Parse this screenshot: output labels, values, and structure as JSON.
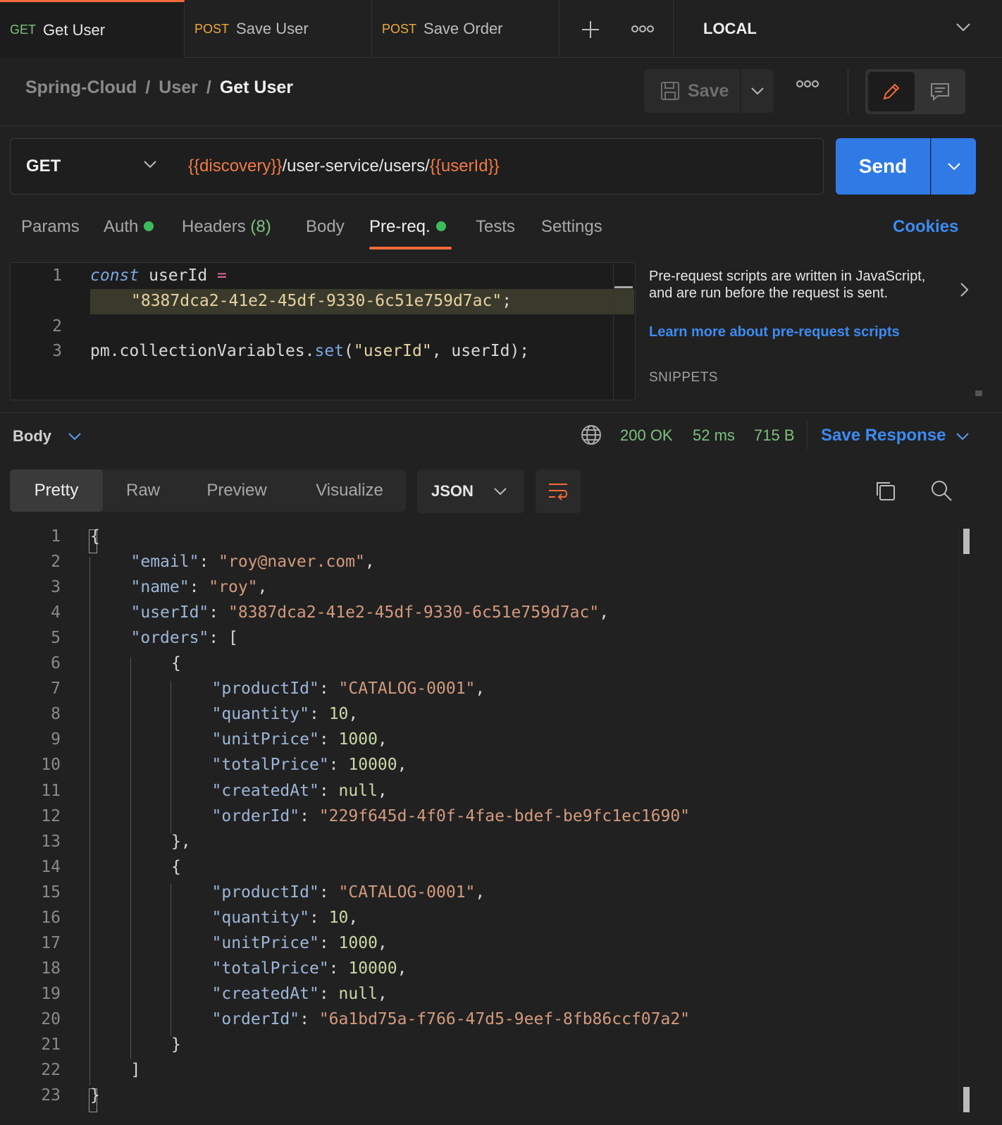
{
  "tabs": [
    {
      "method": "GET",
      "label": "Get User"
    },
    {
      "method": "POST",
      "label": "Save User"
    },
    {
      "method": "POST",
      "label": "Save Order"
    }
  ],
  "environment": "LOCAL",
  "breadcrumb": {
    "collection": "Spring-Cloud",
    "folder": "User",
    "request": "Get User"
  },
  "header": {
    "save_label": "Save"
  },
  "request": {
    "method": "GET",
    "url_var1": "{{discovery}}",
    "url_path": "/user-service/users/",
    "url_var2": "{{userId}}",
    "send_label": "Send"
  },
  "request_tabs": {
    "params": "Params",
    "auth": "Auth",
    "headers": "Headers",
    "headers_count": "(8)",
    "body": "Body",
    "prereq": "Pre-req.",
    "tests": "Tests",
    "settings": "Settings",
    "cookies": "Cookies"
  },
  "script": {
    "line_numbers": [
      "1",
      "2",
      "3"
    ],
    "l1_kw": "const",
    "l1_var": " userId ",
    "l1_op": "=",
    "l1b_str": "\"8387dca2-41e2-45df-9330-6c51e759d7ac\"",
    "l1b_end": ";",
    "l3_obj": "pm.collectionVariables.",
    "l3_fn": "set",
    "l3_open": "(",
    "l3_str": "\"userId\"",
    "l3_rest": ", userId);"
  },
  "info": {
    "text": "Pre-request scripts are written in JavaScript, and are run before the request is sent.",
    "link": "Learn more about pre-request scripts",
    "snippets": "SNIPPETS"
  },
  "response": {
    "body_label": "Body",
    "status": "200 OK",
    "time": "52 ms",
    "size": "715 B",
    "save_response": "Save Response",
    "views": [
      "Pretty",
      "Raw",
      "Preview",
      "Visualize"
    ],
    "format": "JSON",
    "json": {
      "email_key": "\"email\"",
      "email_val": "\"roy@naver.com\"",
      "name_key": "\"name\"",
      "name_val": "\"roy\"",
      "userId_key": "\"userId\"",
      "userId_val": "\"8387dca2-41e2-45df-9330-6c51e759d7ac\"",
      "orders_key": "\"orders\"",
      "orders": [
        {
          "productId": "\"CATALOG-0001\"",
          "quantity": "10",
          "unitPrice": "1000",
          "totalPrice": "10000",
          "createdAt": "null",
          "orderId": "\"229f645d-4f0f-4fae-bdef-be9fc1ec1690\""
        },
        {
          "productId": "\"CATALOG-0001\"",
          "quantity": "10",
          "unitPrice": "1000",
          "totalPrice": "10000",
          "createdAt": "null",
          "orderId": "\"6a1bd75a-f766-47d5-9eef-8fb86ccf07a2\""
        }
      ],
      "keys": {
        "productId": "\"productId\"",
        "quantity": "\"quantity\"",
        "unitPrice": "\"unitPrice\"",
        "totalPrice": "\"totalPrice\"",
        "createdAt": "\"createdAt\"",
        "orderId": "\"orderId\""
      }
    }
  },
  "colors": {
    "accent": "#f26b3a",
    "send": "#2f7ae5",
    "link": "#3d8bf2",
    "ok": "#7fbf7f",
    "post": "#f0a93b"
  }
}
